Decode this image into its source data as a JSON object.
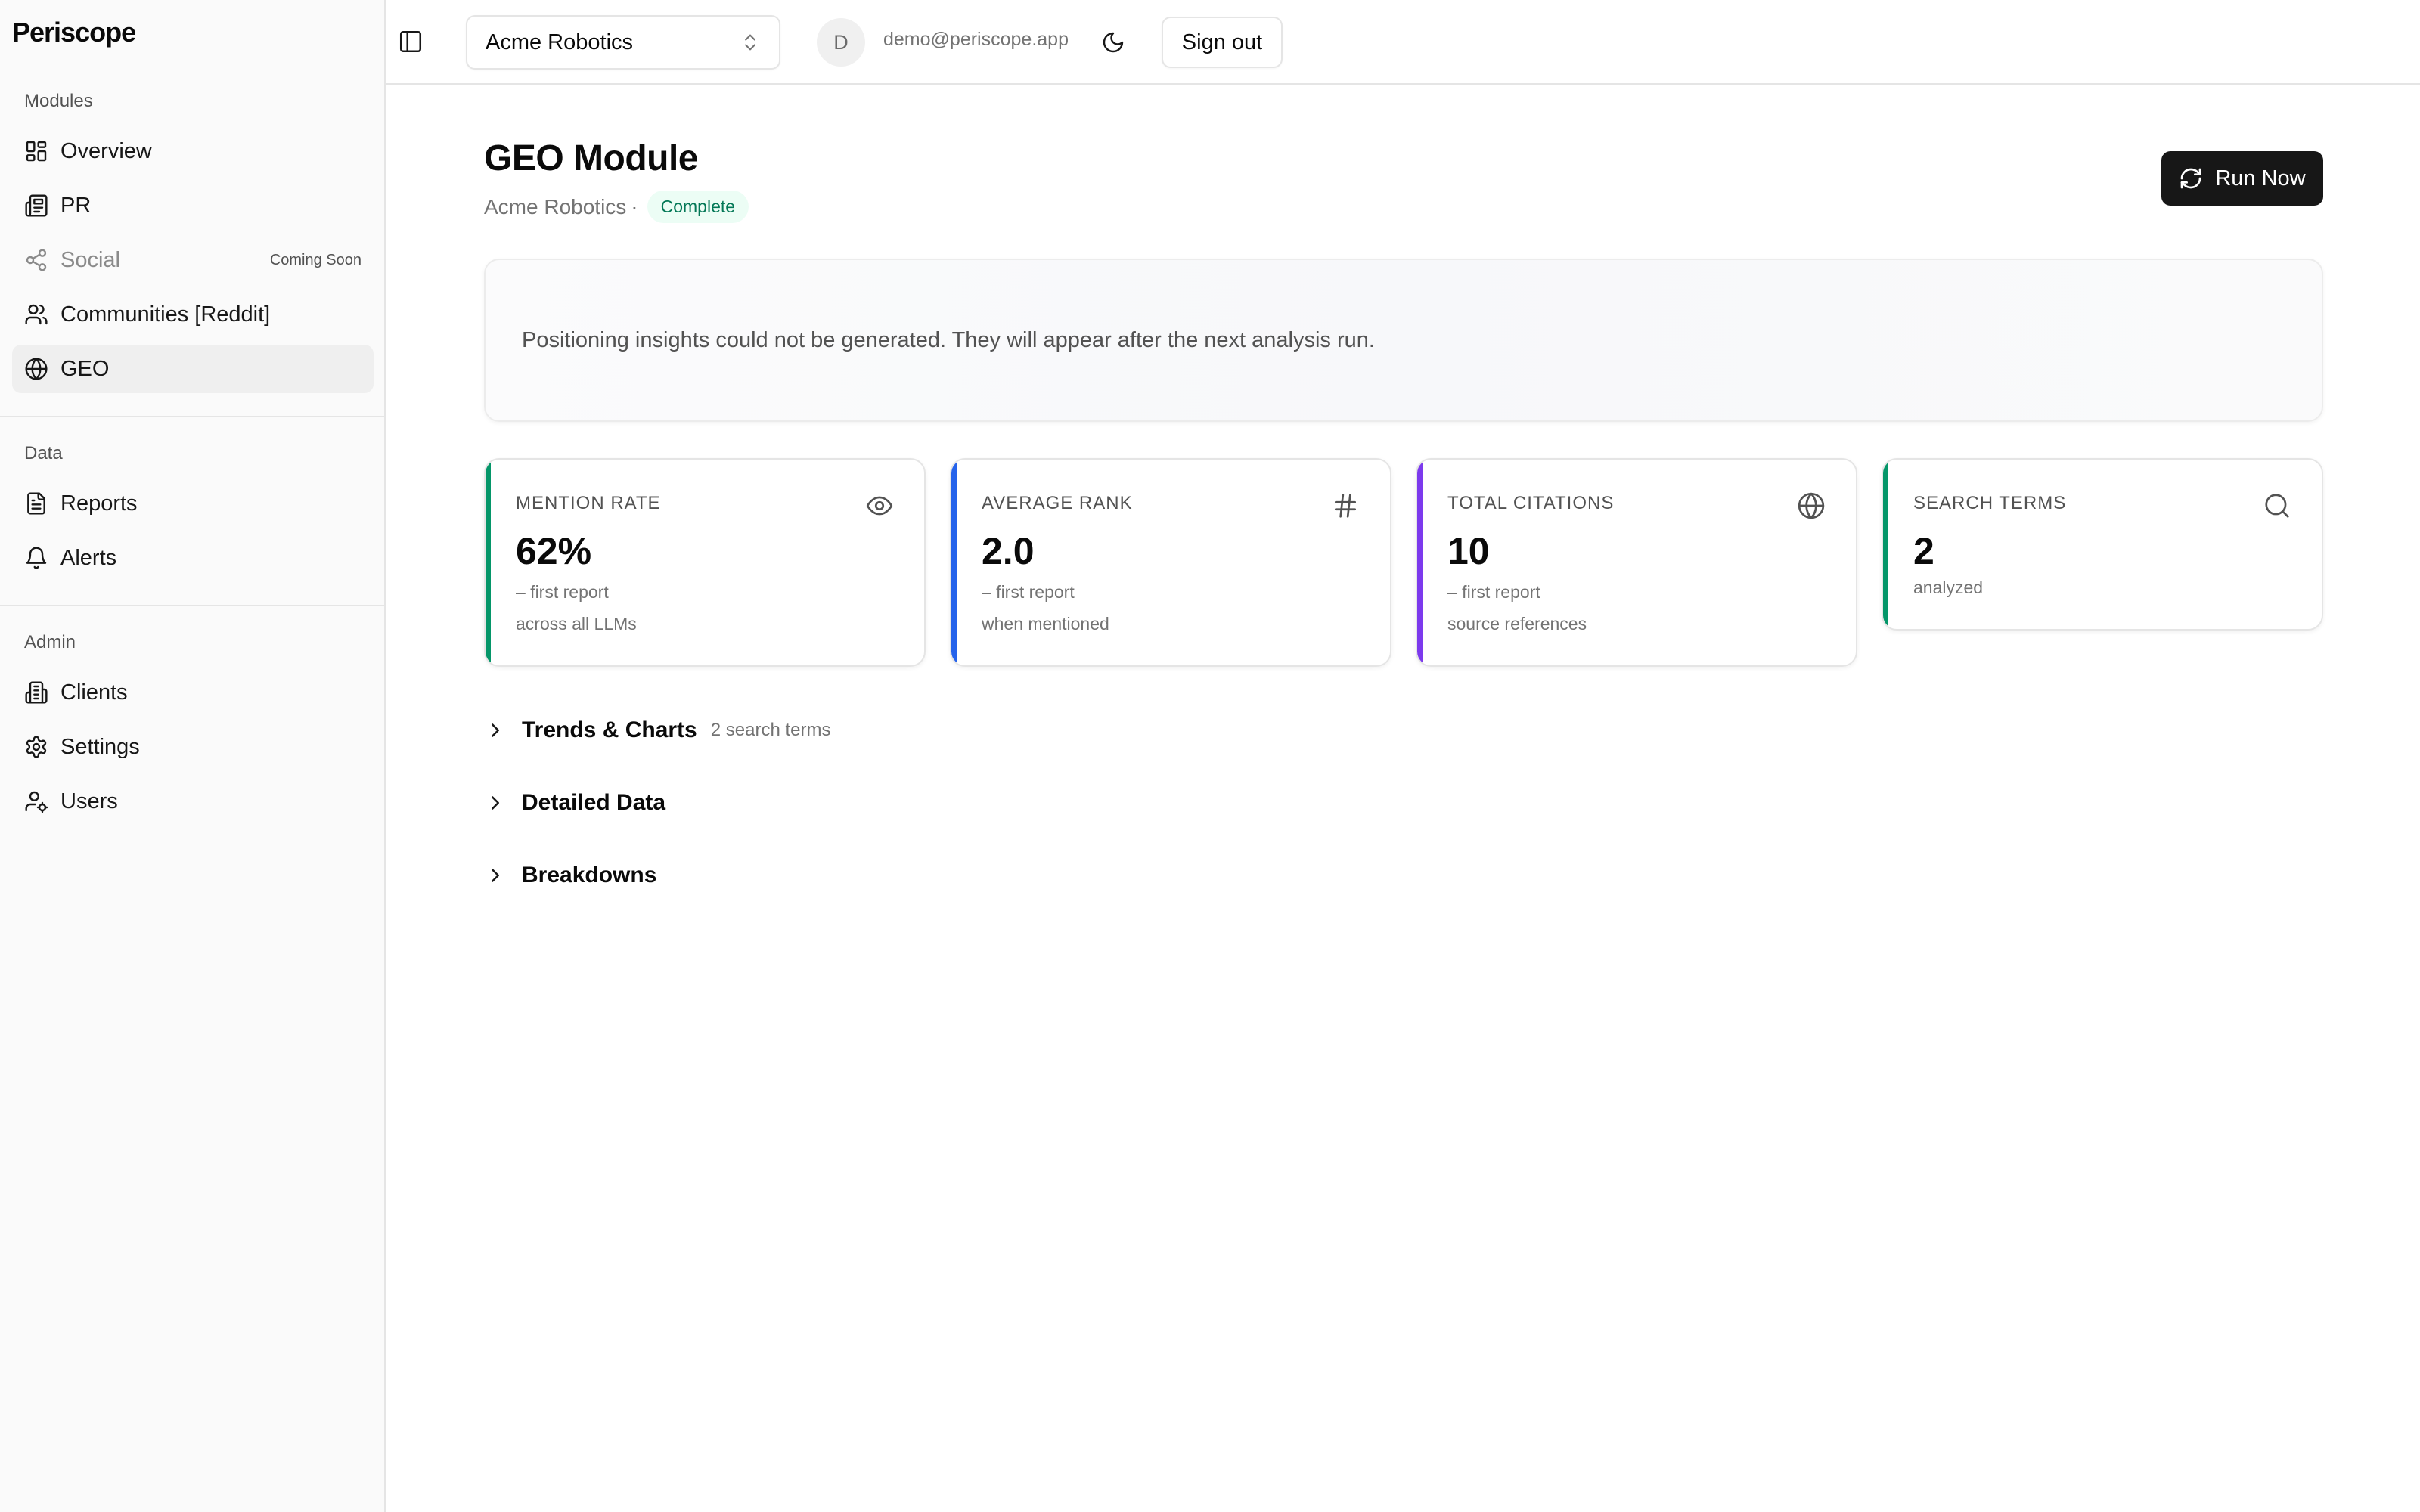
{
  "brand": "Periscope",
  "sidebar": {
    "groups": [
      {
        "label": "Modules"
      },
      {
        "label": "Data"
      },
      {
        "label": "Admin"
      }
    ],
    "items": [
      {
        "label": "Overview",
        "icon": "layout-dashboard-icon"
      },
      {
        "label": "PR",
        "icon": "newspaper-icon"
      },
      {
        "label": "Social",
        "icon": "share-icon",
        "tag": "Coming Soon"
      },
      {
        "label": "Communities [Reddit]",
        "icon": "users-icon"
      },
      {
        "label": "GEO",
        "icon": "globe-icon",
        "active": true
      },
      {
        "label": "Reports",
        "icon": "file-text-icon"
      },
      {
        "label": "Alerts",
        "icon": "bell-icon"
      },
      {
        "label": "Clients",
        "icon": "building-icon"
      },
      {
        "label": "Settings",
        "icon": "gear-icon"
      },
      {
        "label": "Users",
        "icon": "user-cog-icon"
      }
    ]
  },
  "topbar": {
    "client": "Acme Robotics",
    "avatar_initial": "D",
    "email": "demo@periscope.app",
    "signout_label": "Sign out"
  },
  "main": {
    "title": "GEO Module",
    "client": "Acme Robotics",
    "separator": "·",
    "status": "Complete",
    "run_label": "Run Now",
    "insight_text": "Positioning insights could not be generated. They will appear after the next analysis run.",
    "stats": [
      {
        "label": "Mention Rate",
        "value": "62%",
        "line1": "– first report",
        "line2": "across all LLMs",
        "icon": "eye-icon",
        "accent": "#059669"
      },
      {
        "label": "Average Rank",
        "value": "2.0",
        "line1": "– first report",
        "line2": "when mentioned",
        "icon": "hash-icon",
        "accent": "#2563eb"
      },
      {
        "label": "Total Citations",
        "value": "10",
        "line1": "– first report",
        "line2": "source references",
        "icon": "globe-icon",
        "accent": "#7c3aed"
      },
      {
        "label": "Search Terms",
        "value": "2",
        "line1": "analyzed",
        "line2": "",
        "icon": "search-icon",
        "accent": "#059669"
      }
    ],
    "sections": [
      {
        "title": "Trends & Charts",
        "meta": "2 search terms"
      },
      {
        "title": "Detailed Data",
        "meta": ""
      },
      {
        "title": "Breakdowns",
        "meta": ""
      }
    ]
  }
}
